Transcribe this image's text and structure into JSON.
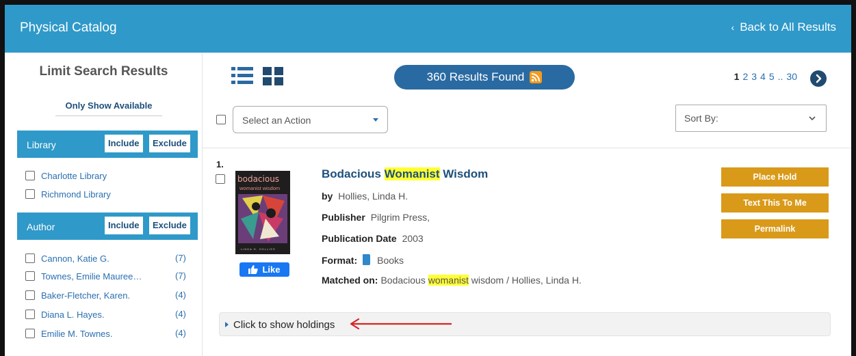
{
  "header": {
    "title": "Physical Catalog",
    "back_link": "Back to All Results"
  },
  "sidebar": {
    "title": "Limit Search Results",
    "only_available": "Only Show Available",
    "facets": [
      {
        "label": "Library",
        "include": "Include",
        "exclude": "Exclude",
        "items": [
          {
            "label": "Charlotte Library",
            "count": ""
          },
          {
            "label": "Richmond Library",
            "count": ""
          }
        ]
      },
      {
        "label": "Author",
        "include": "Include",
        "exclude": "Exclude",
        "items": [
          {
            "label": "Cannon, Katie G.",
            "count": "(7)"
          },
          {
            "label": "Townes, Emilie Mauree…",
            "count": "(7)"
          },
          {
            "label": "Baker-Fletcher, Karen.",
            "count": "(4)"
          },
          {
            "label": "Diana L. Hayes.",
            "count": "(4)"
          },
          {
            "label": "Emilie M. Townes.",
            "count": "(4)"
          }
        ]
      }
    ]
  },
  "toolbar": {
    "results_found": "360 Results Found",
    "action_select": "Select an Action",
    "sort_by": "Sort By:",
    "pagination": {
      "current": "1",
      "pages": [
        "2",
        "3",
        "4",
        "5"
      ],
      "ellipsis": "..",
      "last": "30"
    }
  },
  "record": {
    "number": "1.",
    "title_before": "Bodacious ",
    "title_highlight": "Womanist",
    "title_after": " Wisdom",
    "by_label": "by",
    "author": "Hollies, Linda H.",
    "publisher_label": "Publisher",
    "publisher": "Pilgrim Press,",
    "pubdate_label": "Publication Date",
    "pubdate": "2003",
    "format_label": "Format:",
    "format": "Books",
    "matched_label": "Matched on:",
    "matched_before": "Bodacious ",
    "matched_highlight": "womanist",
    "matched_after": " wisdom / Hollies, Linda H.",
    "cover": {
      "title": "bodacious",
      "subtitle": "womanist wisdom",
      "author": "LINDA H. HOLLIES"
    },
    "like": "Like",
    "actions": [
      "Place Hold",
      "Text This To Me",
      "Permalink"
    ],
    "holdings_toggle": "Click to show holdings"
  },
  "colors": {
    "header_bg": "#2f99c9",
    "link": "#2a6fb0",
    "action_button": "#d99a1a",
    "highlight": "#ffff33",
    "annotation_arrow": "#d42626"
  }
}
